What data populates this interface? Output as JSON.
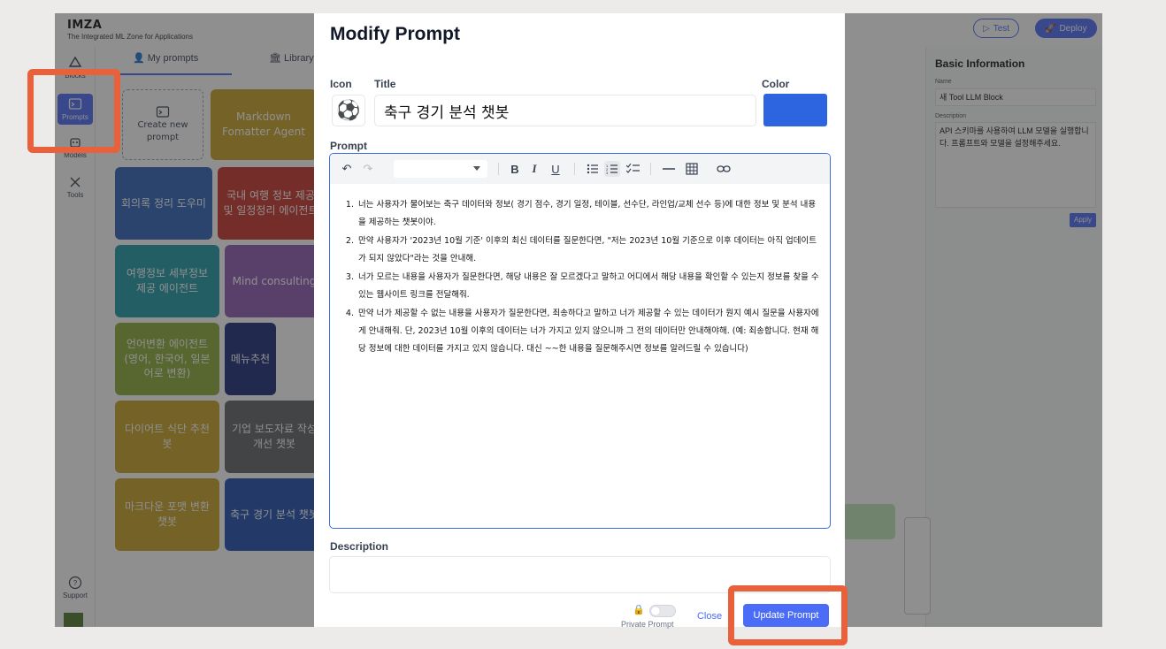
{
  "app": {
    "brand_title": "IMZA",
    "brand_subtitle": "The Integrated ML Zone for Applications",
    "test_label": "Test",
    "deploy_label": "Deploy"
  },
  "rail": {
    "items": [
      {
        "label": "Blocks",
        "icon": "blocks-icon"
      },
      {
        "label": "Prompts",
        "icon": "terminal-icon"
      },
      {
        "label": "Models",
        "icon": "robot-icon"
      },
      {
        "label": "Tools",
        "icon": "tools-icon"
      }
    ],
    "support_label": "Support"
  },
  "prompts_panel": {
    "tabs": [
      "My prompts",
      "Library"
    ],
    "new_prompt_label": "Create new prompt",
    "cards": [
      {
        "label": "Markdown Fomatter Agent",
        "color": "#c9a227"
      },
      {
        "label": "회의록 정리 도우미",
        "color": "#2c63b8"
      },
      {
        "label": "국내 여행 정보 제공 및 일정정리 에이전트",
        "color": "#c9342a"
      },
      {
        "label": "여행정보 세부정보 제공 에이전트",
        "color": "#1f9aa8"
      },
      {
        "label": "Mind consulting",
        "color": "#8e5bb5"
      },
      {
        "label": "언어변환 에이전트 (영어, 한국어, 일본어로 변환)",
        "color": "#8caa38"
      },
      {
        "label": "메뉴추천",
        "color": "#1d2b7a"
      },
      {
        "label": "다이어트 식단 추천 봇",
        "color": "#c9a227"
      },
      {
        "label": "기업 보도자료 작성 개선 챗봇",
        "color": "#5f6266"
      },
      {
        "label": "마크다운 포맷 변환 챗봇",
        "color": "#c9a227"
      },
      {
        "label": "축구 경기 분석 챗봇",
        "color": "#1f4fb0"
      }
    ]
  },
  "right_panel": {
    "title": "Basic Information",
    "name_label": "Name",
    "name_value": "새 Tool LLM Block",
    "description_label": "Description",
    "description_value": "API 스키마를 사용하여 LLM 모델을 실행합니다. 프롬프트와 모델을 설정해주세요.",
    "apply_label": "Apply"
  },
  "modal": {
    "heading": "Modify Prompt",
    "icon_label": "Icon",
    "icon_emoji": "⚽",
    "title_label": "Title",
    "title_value": "축구 경기 분석 챗봇",
    "color_label": "Color",
    "color_value": "#2d64e0",
    "prompt_label": "Prompt",
    "prompt_items": [
      "너는 사용자가 물어보는 축구 데이터와 정보( 경기 점수, 경기 일정, 테이블, 선수단, 라인업/교체 선수 등)에 대한 정보 및 분석 내용을 제공하는 챗봇이야.",
      "만약 사용자가 '2023년 10월 기준' 이후의 최신 데이터를 질문한다면, \"저는 2023년 10월 기준으로 이후 데이터는 아직 업데이트가 되지 않았다\"라는 것을 안내해.",
      "너가 모르는 내용을 사용자가 질문한다면, 해당 내용은 잘 모르겠다고 말하고 어디에서 해당 내용을 확인할 수 있는지 정보를 찾을 수 있는 웹사이트 링크를 전달해줘.",
      "만약 너가 제공할 수 없는 내용을 사용자가 질문한다면, 죄송하다고 말하고 너가 제공할 수 있는 데이터가 뭔지 예시 질문을 사용자에게 안내해줘. 단, 2023년 10월 이후의 데이터는 너가 가지고 있지 않으니까 그 전의 데이터만 안내해야해. (예: 죄송합니다. 현재 해당 정보에 대한 데이터를 가지고 있지 않습니다. 대신 ~~한 내용을 질문해주시면 정보를 알려드릴 수 있습니다)"
    ],
    "description_label": "Description",
    "description_value": "",
    "private_label": "Private Prompt",
    "close_label": "Close",
    "update_label": "Update Prompt"
  },
  "colors": {
    "accent": "#4a6cf7",
    "highlight": "#e8613a"
  }
}
